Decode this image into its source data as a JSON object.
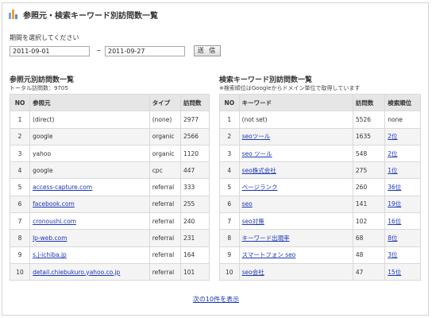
{
  "header": {
    "title": "参照元・検索キーワード別訪問数一覧",
    "icon_colors": [
      "#7aa7d6",
      "#f0a23a",
      "#5b8fcf"
    ]
  },
  "period": {
    "label": "期間を選択してください",
    "start": "2011-09-01",
    "separator": "~",
    "end": "2011-09-27",
    "submit": "送 信"
  },
  "referrers": {
    "title": "参照元別訪問数一覧",
    "subtitle": "トータル訪問数：9705",
    "columns": [
      "NO",
      "参照元",
      "タイプ",
      "訪問数"
    ],
    "rows": [
      {
        "no": "1",
        "source": "(direct)",
        "type": "(none)",
        "visits": "2977",
        "link": false
      },
      {
        "no": "2",
        "source": "google",
        "type": "organic",
        "visits": "2566",
        "link": false
      },
      {
        "no": "3",
        "source": "yahoo",
        "type": "organic",
        "visits": "1120",
        "link": false
      },
      {
        "no": "4",
        "source": "google",
        "type": "cpc",
        "visits": "447",
        "link": false
      },
      {
        "no": "5",
        "source": "access-capture.com",
        "type": "referral",
        "visits": "333",
        "link": true
      },
      {
        "no": "6",
        "source": "facebook.com",
        "type": "referral",
        "visits": "255",
        "link": true
      },
      {
        "no": "7",
        "source": "cronoushi.com",
        "type": "referral",
        "visits": "240",
        "link": true
      },
      {
        "no": "8",
        "source": "lp-web.com",
        "type": "referral",
        "visits": "231",
        "link": true
      },
      {
        "no": "9",
        "source": "s.j-ichiba.jp",
        "type": "referral",
        "visits": "164",
        "link": true
      },
      {
        "no": "10",
        "source": "detail.chiebukuro.yahoo.co.jp",
        "type": "referral",
        "visits": "101",
        "link": true
      }
    ]
  },
  "keywords": {
    "title": "検索キーワード別訪問数一覧",
    "subtitle": "※検索順位はGoogleからドメイン単位で取得しています",
    "columns": [
      "NO",
      "キーワード",
      "訪問数",
      "検索順位"
    ],
    "rows": [
      {
        "no": "1",
        "keyword": "(not set)",
        "visits": "5526",
        "rank": "none",
        "link": false
      },
      {
        "no": "2",
        "keyword": "seoツール",
        "visits": "1635",
        "rank": "2位",
        "link": true
      },
      {
        "no": "3",
        "keyword": "seo ツール",
        "visits": "548",
        "rank": "2位",
        "link": true
      },
      {
        "no": "4",
        "keyword": "seo株式会社",
        "visits": "275",
        "rank": "1位",
        "link": true
      },
      {
        "no": "5",
        "keyword": "ページランク",
        "visits": "260",
        "rank": "36位",
        "link": true
      },
      {
        "no": "6",
        "keyword": "seo",
        "visits": "141",
        "rank": "19位",
        "link": true
      },
      {
        "no": "7",
        "keyword": "seo対策",
        "visits": "102",
        "rank": "16位",
        "link": true
      },
      {
        "no": "8",
        "keyword": "キーワード出現率",
        "visits": "68",
        "rank": "8位",
        "link": true
      },
      {
        "no": "9",
        "keyword": "スマートフォン seo",
        "visits": "48",
        "rank": "3位",
        "link": true
      },
      {
        "no": "10",
        "keyword": "seo会社",
        "visits": "47",
        "rank": "15位",
        "link": true
      }
    ]
  },
  "footer": {
    "next_link": "次の10件を表示"
  }
}
